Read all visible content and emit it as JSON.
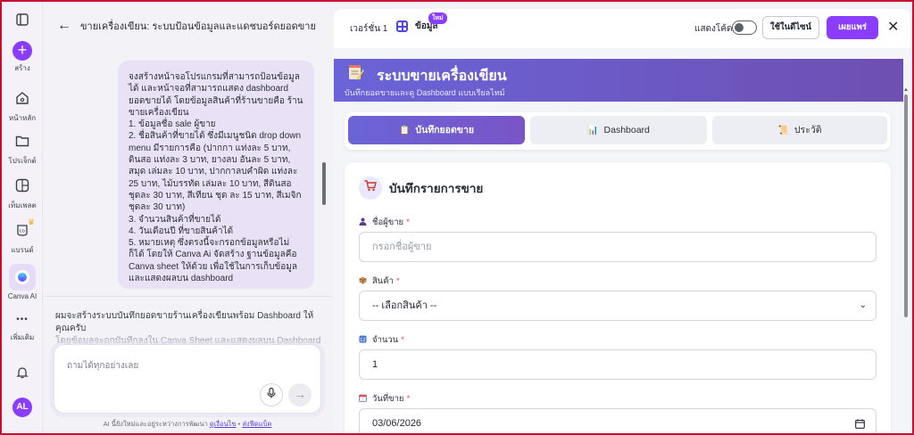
{
  "rail": {
    "items": [
      {
        "label": "",
        "icon": "sidebar-toggle-icon"
      },
      {
        "label": "สร้าง",
        "icon": "plus-icon"
      },
      {
        "label": "หน้าหลัก",
        "icon": "home-icon"
      },
      {
        "label": "โปรเจ็กต์",
        "icon": "folder-icon"
      },
      {
        "label": "เท็มเพลต",
        "icon": "template-icon"
      },
      {
        "label": "แบรนด์",
        "icon": "brand-icon"
      },
      {
        "label": "Canva AI",
        "icon": "canva-ai-icon"
      },
      {
        "label": "เพิ่มเติม",
        "icon": "more-icon"
      }
    ],
    "more_glyph": "•••",
    "avatar_initials": "AL"
  },
  "chat": {
    "title": "ขายเครื่องเขียน: ระบบป้อนข้อมูลและแดชบอร์ดยอดขาย",
    "user_message_lines": [
      "จงสร้างหน้าจอโปรแกรมที่สามารถป้อนข้อมูลได้ และหน้าจอที่สามารถแสดง dashboard ยอดขายได้ โดยข้อมูลสินค้าที่ร้านขายคือ ร้านขายเครื่องเขียน",
      "1. ข้อมูลชื่อ sale ผู้ขาย",
      "2. ชื่อสินค้าที่ขายได้ ซึ่งมีเมนูชนิด drop down menu มีรายการคือ (ปากกา แท่งละ 5 บาท, ดินสอ แท่งละ 3 บาท, ยางลบ อันละ 5 บาท, สมุด เล่มละ 10 บาท, ปากกาลบคำผิด แท่งละ 25 บาท, ไม้บรรทัด เล่มละ 10 บาท, สีดินสอ ชุดละ 30 บาท, สีเทียน ชุด ละ 15 บาท, สีเมจิก ชุดละ 30 บาท)",
      "3. จำนวนสินค้าที่ขายได้",
      "4. วันเดือนปี ที่ขายสินค้าได้",
      "5. หมายเหตุ ซึ่งตรงนี้จะกรอกข้อมูลหรือไม่ก็ได้ โดยให้ Canva Ai จัดสร้าง ฐานข้อมูลคือ Canva sheet ให้ด้วย เพื่อใช้ในการเก็บข้อมูลและแสดงผลบน dashboard"
    ],
    "assistant_line1": "ผมจะสร้างระบบบันทึกยอดขายร้านเครื่องเขียนพร้อม Dashboard ให้คุณครับ",
    "assistant_line2": "โดยข้อมูลจะถูกบันทึกลงใน Canva Sheet และแสดงผลบน Dashboard",
    "input_placeholder": "ถามได้ทุกอย่างเลย",
    "disclaimer_prefix": "AI นี้ยังใหม่และอยู่ระหว่างการพัฒนา",
    "terms_link": "ดูเงื่อนไข",
    "separator": "•",
    "feedback_link": "ส่งฟีดแบ็ค"
  },
  "preview": {
    "version_label": "เวอร์ชั่น 1",
    "data_label": "ข้อมูล",
    "new_badge": "ใหม่",
    "show_code_label": "แสดงโค้ด",
    "show_code_on": false,
    "use_in_design_label": "ใช้ในดีไซน์",
    "publish_label": "เผยแพร่",
    "close_glyph": "✕"
  },
  "app": {
    "title": "ระบบขายเครื่องเขียน",
    "subtitle": "บันทึกยอดขายและดู Dashboard แบบเรียลไทม์",
    "tabs": [
      {
        "label": "บันทึกยอดขาย",
        "icon": "clipboard-icon",
        "glyph": "📋",
        "active": true
      },
      {
        "label": "Dashboard",
        "icon": "bar-chart-icon",
        "glyph": "📊",
        "active": false
      },
      {
        "label": "ประวัติ",
        "icon": "scroll-icon",
        "glyph": "📜",
        "active": false
      }
    ],
    "form": {
      "title": "บันทึกรายการขาย",
      "seller": {
        "label": "ชื่อผู้ขาย",
        "required": "*",
        "placeholder": "กรอกชื่อผู้ขาย",
        "value": ""
      },
      "product": {
        "label": "สินค้า",
        "required": "*",
        "selected": "-- เลือกสินค้า --"
      },
      "quantity": {
        "label": "จำนวน",
        "required": "*",
        "value": "1"
      },
      "date": {
        "label": "วันที่ขาย",
        "required": "*",
        "value": "03/06/2026"
      }
    }
  },
  "colors": {
    "brand_purple": "#8b3dff",
    "hero_gradient_start": "#6a64d8",
    "hero_gradient_end": "#6e4fb2",
    "required": "#e5484d"
  }
}
